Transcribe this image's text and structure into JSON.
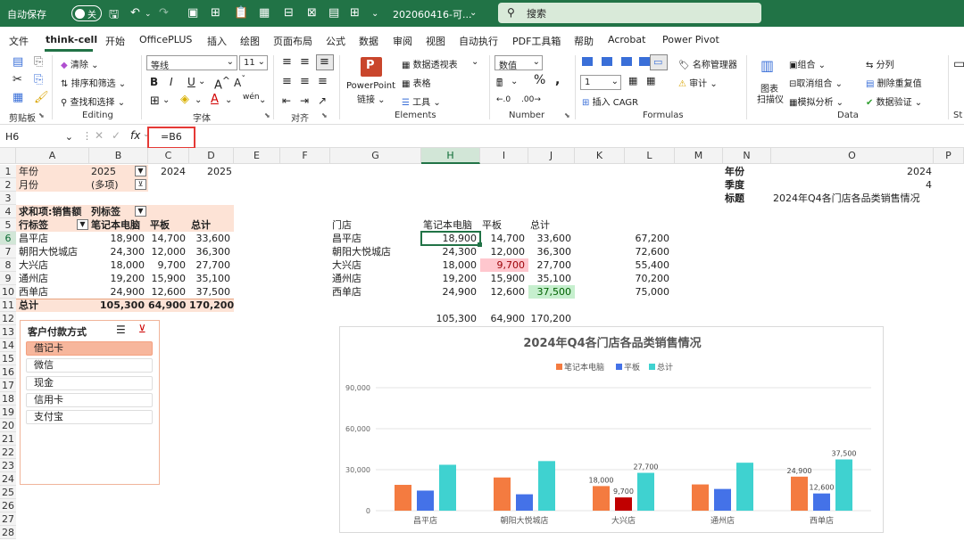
{
  "titlebar": {
    "autosave_label": "自动保存",
    "autosave_state": "关",
    "filename": "202060416-可...",
    "search_placeholder": "搜索"
  },
  "menu": [
    "文件",
    "think-cell",
    "开始",
    "OfficePLUS",
    "插入",
    "绘图",
    "页面布局",
    "公式",
    "数据",
    "审阅",
    "视图",
    "自动执行",
    "PDF工具箱",
    "帮助",
    "Acrobat",
    "Power Pivot"
  ],
  "menu_active": "think-cell",
  "ribbon": {
    "clipboard_group": "剪贴板",
    "clear": "清除",
    "sort_filter": "排序和筛选",
    "find_select": "查找和选择",
    "editing_group": "Editing",
    "font_name": "等线",
    "font_size": "11",
    "font_group": "字体",
    "align_group": "对齐",
    "powerpoint": "PowerPoint",
    "link": "链接",
    "pivot_table": "数据透视表",
    "table": "表格",
    "tools": "工具",
    "elements_group": "Elements",
    "number_format": "数值",
    "number_group": "Number",
    "number_sel": "1",
    "insert_cagr": "插入 CAGR",
    "formulas_group": "Formulas",
    "name_manager": "名称管理器",
    "audit": "审计",
    "chart_scanner": "图表",
    "chart_scanner2": "扫描仪",
    "combine": "组合",
    "ungroup": "取消组合",
    "simulate": "模拟分析",
    "split": "分列",
    "remove_dup": "删除重复值",
    "data_validation": "数据验证",
    "data_group": "Data"
  },
  "formula": {
    "namebox": "H6",
    "formula_text": "=B6"
  },
  "columns": [
    "A",
    "B",
    "C",
    "D",
    "E",
    "F",
    "G",
    "H",
    "I",
    "J",
    "K",
    "L",
    "M",
    "N",
    "O",
    "P"
  ],
  "selected_column": "H",
  "rows": [
    "1",
    "2",
    "3",
    "4",
    "5",
    "6",
    "7",
    "8",
    "9",
    "10",
    "11",
    "12",
    "13",
    "14",
    "15",
    "16",
    "17",
    "18",
    "19",
    "20",
    "21",
    "22",
    "23",
    "24",
    "25",
    "26",
    "27",
    "28"
  ],
  "selected_row": "6",
  "pivot": {
    "a1": "年份",
    "b1": "2025",
    "c1": "2024",
    "d1": "2025",
    "a2": "月份",
    "b2": "(多项)",
    "a4": "求和项:销售额",
    "b4": "列标签",
    "a5": "行标签",
    "b5": "笔记本电脑",
    "c5": "平板",
    "d5": "总计",
    "rows": [
      {
        "store": "昌平店",
        "laptop": "18,900",
        "tablet": "14,700",
        "total": "33,600"
      },
      {
        "store": "朝阳大悦城店",
        "laptop": "24,300",
        "tablet": "12,000",
        "total": "36,300"
      },
      {
        "store": "大兴店",
        "laptop": "18,000",
        "tablet": "9,700",
        "total": "27,700"
      },
      {
        "store": "通州店",
        "laptop": "19,200",
        "tablet": "15,900",
        "total": "35,100"
      },
      {
        "store": "西单店",
        "laptop": "24,900",
        "tablet": "12,600",
        "total": "37,500"
      }
    ],
    "total_label": "总计",
    "total_laptop": "105,300",
    "total_tablet": "64,900",
    "total_total": "170,200"
  },
  "table2": {
    "g5": "门店",
    "h5": "笔记本电脑",
    "i5": "平板",
    "j5": "总计",
    "l": [
      "67,200",
      "72,600",
      "55,400",
      "70,200",
      "75,000"
    ],
    "sum_h": "105,300",
    "sum_i": "64,900",
    "sum_j": "170,200"
  },
  "params": {
    "n1": "年份",
    "o1": "2024",
    "n2": "季度",
    "o2": "4",
    "n3": "标题",
    "o3": "2024年Q4各门店各品类销售情况"
  },
  "slicer": {
    "title": "客户付款方式",
    "items": [
      "借记卡",
      "微信",
      "现金",
      "信用卡",
      "支付宝"
    ],
    "selected": "借记卡"
  },
  "chart_data": {
    "type": "bar",
    "title": "2024年Q4各门店各品类销售情况",
    "categories": [
      "昌平店",
      "朝阳大悦城店",
      "大兴店",
      "通州店",
      "西单店"
    ],
    "series": [
      {
        "name": "笔记本电脑",
        "values": [
          18900,
          24300,
          18000,
          19200,
          24900
        ],
        "color": "#f47b40"
      },
      {
        "name": "平板",
        "values": [
          14700,
          12000,
          9700,
          15900,
          12600
        ],
        "color": "#4472e8"
      },
      {
        "name": "总计",
        "values": [
          33600,
          36300,
          27700,
          35100,
          37500
        ],
        "color": "#3fd2d0"
      }
    ],
    "highlight": {
      "category": "大兴店",
      "series": "平板",
      "color": "#c00000"
    },
    "yticks": [
      "0",
      "30,000",
      "60,000",
      "90,000"
    ],
    "ylim": [
      0,
      90000
    ],
    "data_labels": [
      {
        "category": "大兴店",
        "series": "笔记本电脑",
        "text": "18,000"
      },
      {
        "category": "大兴店",
        "series": "平板",
        "text": "9,700"
      },
      {
        "category": "大兴店",
        "series": "总计",
        "text": "27,700"
      },
      {
        "category": "西单店",
        "series": "笔记本电脑",
        "text": "24,900"
      },
      {
        "category": "西单店",
        "series": "平板",
        "text": "12,600"
      },
      {
        "category": "西单店",
        "series": "总计",
        "text": "37,500"
      }
    ],
    "legend": "top",
    "grid": true
  }
}
